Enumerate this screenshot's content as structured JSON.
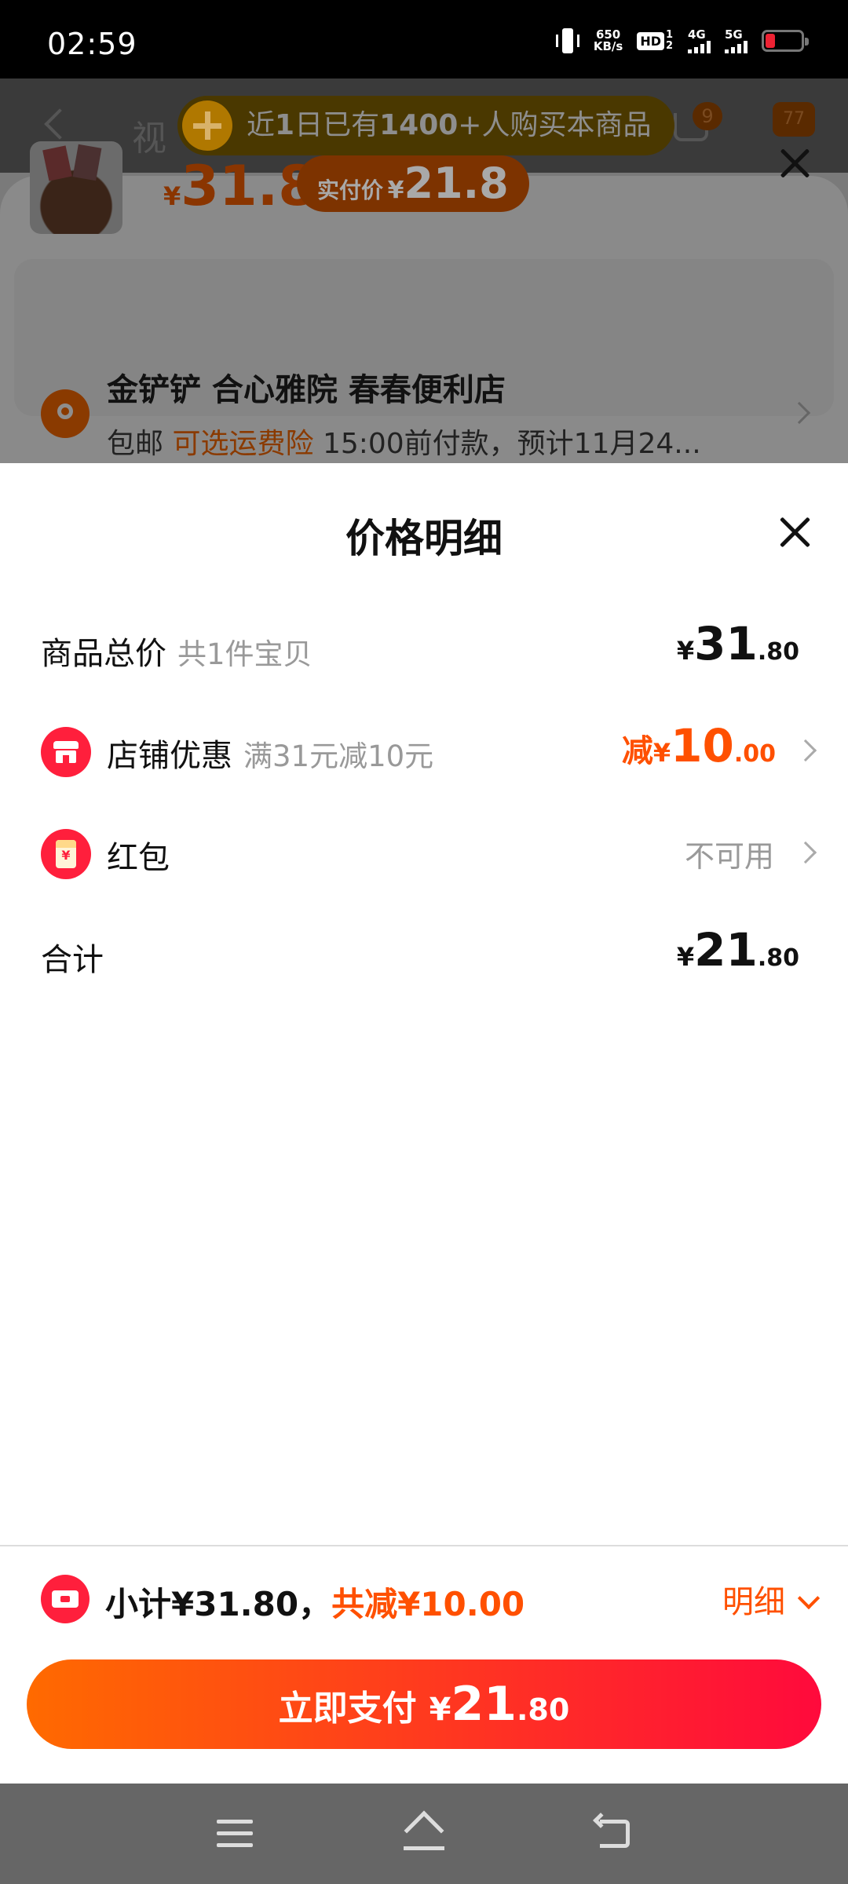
{
  "status_bar": {
    "time": "02:59",
    "net_speed_value": "650",
    "net_speed_unit": "KB/s",
    "hd_label": "HD",
    "hd_sub": "1 2",
    "signal_1": "4G",
    "signal_2": "5G",
    "battery_color": "#ee2233"
  },
  "background": {
    "nav_text": "视",
    "cart_badge": "9",
    "more_badge": "77",
    "promo_prefix": "近",
    "promo_num1": "1",
    "promo_mid": "日已有",
    "promo_num2": "1400",
    "promo_suffix": "+人购买本商品",
    "price_yen": "¥",
    "price": "31.8",
    "paid_label": "实付价",
    "paid_yen": "¥",
    "paid_price": "21.8",
    "address_name": "金铲铲 合心雅院 春春便利店",
    "shipping_free": "包邮",
    "shipping_insurance": "可选运费险",
    "shipping_eta": "15:00前付款，预计11月24..."
  },
  "sheet": {
    "title": "价格明细",
    "rows": {
      "total": {
        "label": "商品总价",
        "sub": "共1件宝贝",
        "yen": "¥",
        "int": "31",
        "dec": ".80"
      },
      "shop_discount": {
        "label": "店铺优惠",
        "sub": "满31元减10元",
        "minus": "减",
        "yen": "¥",
        "int": "10",
        "dec": ".00"
      },
      "red_packet": {
        "label": "红包",
        "status": "不可用",
        "icon_text": "¥"
      },
      "grand_total": {
        "label": "合计",
        "yen": "¥",
        "int": "21",
        "dec": ".80"
      }
    }
  },
  "bottom": {
    "subtotal_text": "小计¥31.80，",
    "discount_text": "共减¥10.00",
    "detail_toggle": "明细",
    "pay_label": "立即支付",
    "pay_yen": "¥",
    "pay_int": "21",
    "pay_dec": ".80",
    "accent_color": "#ff5000",
    "button_gradient": [
      "#ff6a00",
      "#ff0a3c"
    ]
  }
}
